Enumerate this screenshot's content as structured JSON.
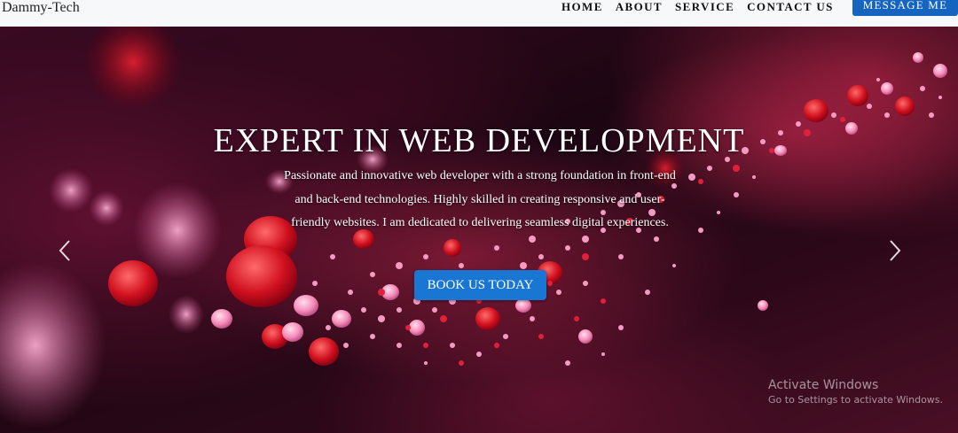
{
  "navbar": {
    "brand": "Dammy-Tech",
    "links": [
      "HOME",
      "ABOUT",
      "SERVICE",
      "CONTACT US"
    ],
    "cta_label": "MESSAGE ME",
    "cta_color": "#1565c0"
  },
  "hero": {
    "title": "EXPERT IN WEB DEVELOPMENT",
    "description": "Passionate and innovative web developer with a strong foundation in front-end and back-end technologies. Highly skilled in creating responsive and user-friendly websites. I am dedicated to delivering seamless digital experiences.",
    "button_label": "BOOK US TODAY",
    "button_color": "#1976d2",
    "prev_icon": "chevron-left-icon",
    "next_icon": "chevron-right-icon"
  },
  "watermark": {
    "title": "Activate Windows",
    "subtitle": "Go to Settings to activate Windows."
  }
}
